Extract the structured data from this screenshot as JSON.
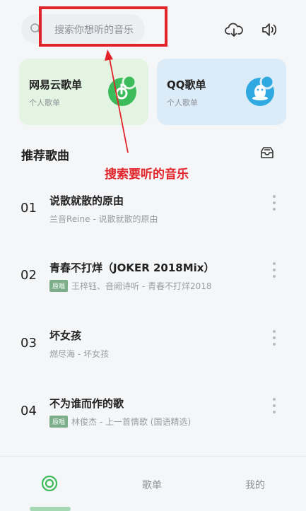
{
  "search": {
    "placeholder": "搜索你想听的音乐"
  },
  "header_icons": [
    "download-cloud-icon",
    "speaker-volume-icon"
  ],
  "playlist_cards": [
    {
      "title": "网易云歌单",
      "subtitle": "个人歌单",
      "icon": "netease-music-icon",
      "color": "#3bbb5a"
    },
    {
      "title": "QQ歌单",
      "subtitle": "个人歌单",
      "icon": "qq-penguin-icon",
      "color": "#2fa9e0"
    }
  ],
  "section": {
    "title": "推荐歌曲",
    "icon": "inbox-tray-icon"
  },
  "annotation": {
    "text": "搜索要听的音乐",
    "color": "#e2242a"
  },
  "songs": [
    {
      "number": "01",
      "title": "说散就散的原由",
      "badge": "",
      "subtitle": "兰音Reine - 说散就散的原由"
    },
    {
      "number": "02",
      "title": "青春不打烊（JOKER 2018Mix）",
      "badge": "原唱",
      "subtitle": "王梓钰、音阙诗听 - 青春不打烊2018"
    },
    {
      "number": "03",
      "title": "坏女孩",
      "badge": "",
      "subtitle": "燃尽海 - 坏女孩"
    },
    {
      "number": "04",
      "title": "不为谁而作的歌",
      "badge": "原唱",
      "subtitle": "林俊杰 - 上一首情歌 (国语精选)"
    }
  ],
  "tabs": [
    {
      "label": "",
      "icon": "home-circle-icon",
      "active": true
    },
    {
      "label": "歌单",
      "active": false
    },
    {
      "label": "我的",
      "active": false
    }
  ],
  "colors": {
    "accent_green": "#3bbb5a",
    "annotation_red": "#e2242a"
  }
}
